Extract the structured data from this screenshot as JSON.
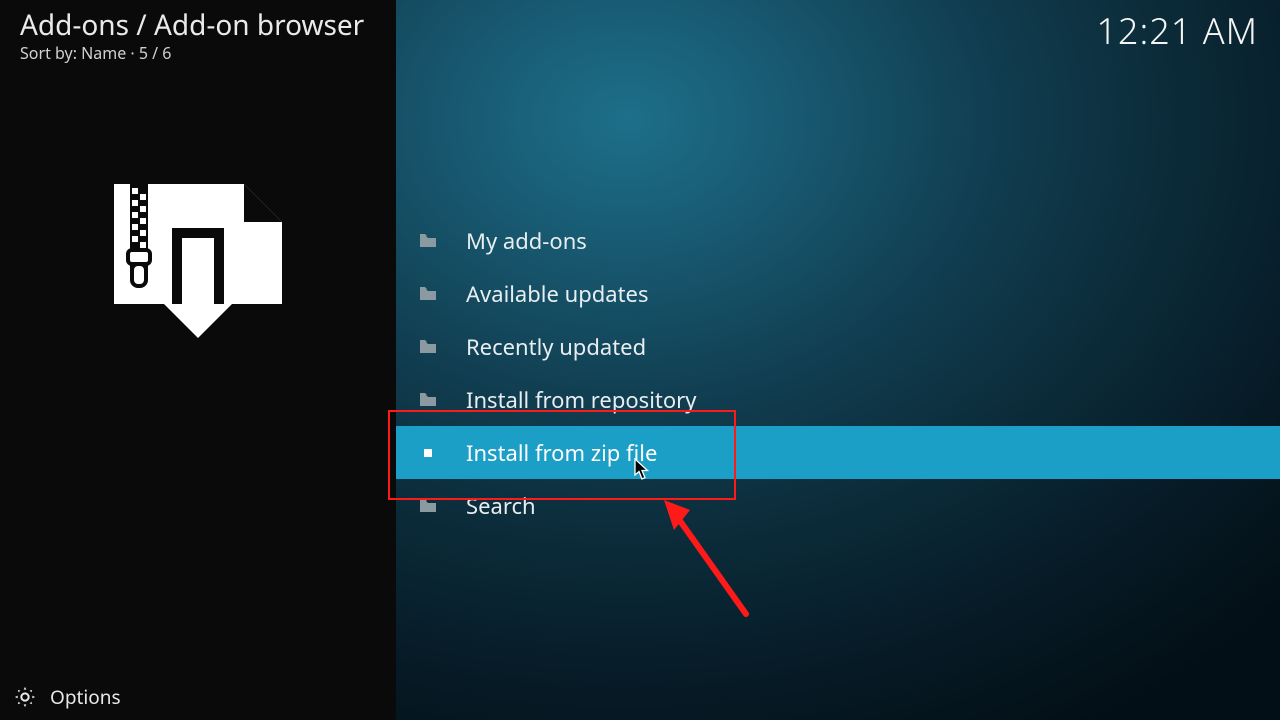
{
  "header": {
    "breadcrumb": "Add-ons / Add-on browser",
    "sortline": "Sort by: Name  ·  5 / 6",
    "clock": "12:21 AM"
  },
  "menu": {
    "items": [
      {
        "label": "My add-ons",
        "selected": false
      },
      {
        "label": "Available updates",
        "selected": false
      },
      {
        "label": "Recently updated",
        "selected": false
      },
      {
        "label": "Install from repository",
        "selected": false
      },
      {
        "label": "Install from zip file",
        "selected": true
      },
      {
        "label": "Search",
        "selected": false
      }
    ]
  },
  "footer": {
    "options_label": "Options"
  }
}
